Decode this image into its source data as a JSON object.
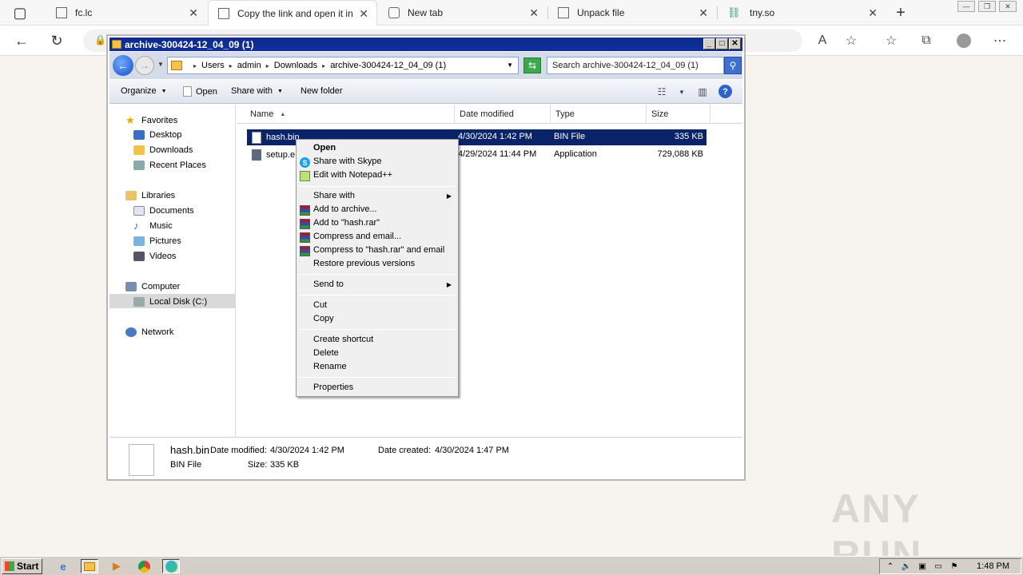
{
  "browser": {
    "tabs": [
      {
        "label": "fc.lc",
        "active": false
      },
      {
        "label": "Copy the link and open it in",
        "active": true
      },
      {
        "label": "New tab",
        "active": false
      },
      {
        "label": "Unpack file",
        "active": false
      },
      {
        "label": "tny.so",
        "active": false
      }
    ]
  },
  "explorer": {
    "title": "archive-300424-12_04_09 (1)",
    "breadcrumb": [
      "Users",
      "admin",
      "Downloads",
      "archive-300424-12_04_09 (1)"
    ],
    "search_placeholder": "Search archive-300424-12_04_09 (1)",
    "commands": {
      "organize": "Organize",
      "open": "Open",
      "share_with": "Share with",
      "new_folder": "New folder"
    },
    "nav": {
      "favorites": "Favorites",
      "favorites_items": [
        "Desktop",
        "Downloads",
        "Recent Places"
      ],
      "libraries": "Libraries",
      "libraries_items": [
        "Documents",
        "Music",
        "Pictures",
        "Videos"
      ],
      "computer": "Computer",
      "computer_items": [
        "Local Disk (C:)"
      ],
      "network": "Network"
    },
    "columns": [
      "Name",
      "Date modified",
      "Type",
      "Size"
    ],
    "files": [
      {
        "name": "hash.bin",
        "date": "4/30/2024 1:42 PM",
        "type": "BIN File",
        "size": "335 KB",
        "selected": true
      },
      {
        "name": "setup.e",
        "date": "4/29/2024 11:44 PM",
        "type": "Application",
        "size": "729,088 KB",
        "selected": false
      }
    ],
    "details": {
      "filename": "hash.bin",
      "modified_label": "Date modified:",
      "modified_value": "4/30/2024 1:42 PM",
      "created_label": "Date created:",
      "created_value": "4/30/2024 1:47 PM",
      "type": "BIN File",
      "size_label": "Size:",
      "size_value": "335 KB"
    }
  },
  "context_menu": {
    "open": "Open",
    "share_skype": "Share with Skype",
    "edit_notepad": "Edit with Notepad++",
    "share_with": "Share with",
    "add_archive": "Add to archive...",
    "add_rar": "Add to \"hash.rar\"",
    "compress_email": "Compress and email...",
    "compress_rar_email": "Compress to \"hash.rar\" and email",
    "restore": "Restore previous versions",
    "send_to": "Send to",
    "cut": "Cut",
    "copy": "Copy",
    "create_shortcut": "Create shortcut",
    "delete": "Delete",
    "rename": "Rename",
    "properties": "Properties"
  },
  "taskbar": {
    "start": "Start",
    "clock": "1:48 PM"
  },
  "watermark": "ANY RUN"
}
